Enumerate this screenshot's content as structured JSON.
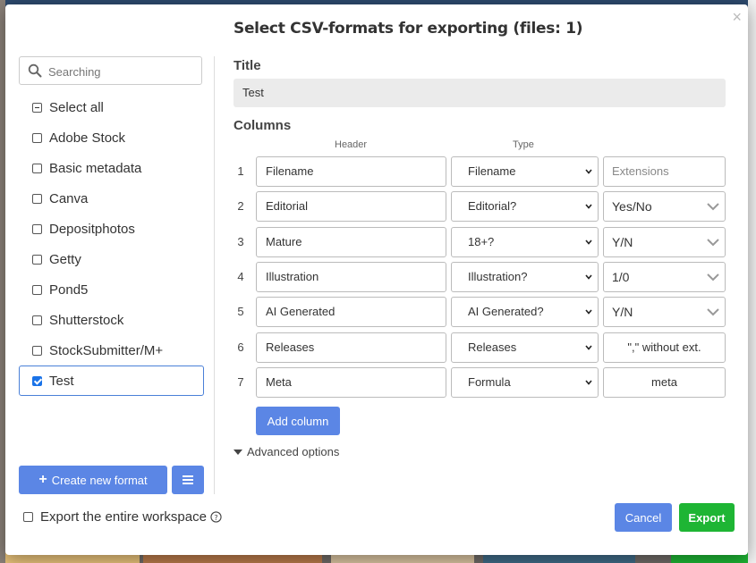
{
  "dialog": {
    "title": "Select CSV-formats for exporting (files: 1)",
    "close_glyph": "×"
  },
  "search": {
    "placeholder": "Searching",
    "value": ""
  },
  "formats": {
    "select_all_label": "Select all",
    "items": [
      {
        "label": "Adobe Stock",
        "checked": false
      },
      {
        "label": "Basic metadata",
        "checked": false
      },
      {
        "label": "Canva",
        "checked": false
      },
      {
        "label": "Depositphotos",
        "checked": false
      },
      {
        "label": "Getty",
        "checked": false
      },
      {
        "label": "Pond5",
        "checked": false
      },
      {
        "label": "Shutterstock",
        "checked": false
      },
      {
        "label": "StockSubmitter/M+",
        "checked": false
      },
      {
        "label": "Test",
        "checked": true
      }
    ],
    "create_label": "Create new format"
  },
  "editor": {
    "title_label": "Title",
    "title_value": "Test",
    "columns_label": "Columns",
    "header_col_label": "Header",
    "type_col_label": "Type",
    "rows": [
      {
        "num": "1",
        "header": "Filename",
        "type": "Filename",
        "extra": "Extensions",
        "extra_kind": "placeholder"
      },
      {
        "num": "2",
        "header": "Editorial",
        "type": "Editorial?",
        "extra": "Yes/No",
        "extra_kind": "select"
      },
      {
        "num": "3",
        "header": "Mature",
        "type": "18+?",
        "extra": "Y/N",
        "extra_kind": "select"
      },
      {
        "num": "4",
        "header": "Illustration",
        "type": "Illustration?",
        "extra": "1/0",
        "extra_kind": "select"
      },
      {
        "num": "5",
        "header": "AI Generated",
        "type": "AI Generated?",
        "extra": "Y/N",
        "extra_kind": "select"
      },
      {
        "num": "6",
        "header": "Releases",
        "type": "Releases",
        "extra": "\",\" without ext.",
        "extra_kind": "center"
      },
      {
        "num": "7",
        "header": "Meta",
        "type": "Formula",
        "extra": "meta",
        "extra_kind": "center"
      }
    ],
    "add_column_label": "Add column",
    "advanced_label": "Advanced options"
  },
  "footer": {
    "workspace_label": "Export the entire workspace",
    "cancel_label": "Cancel",
    "export_label": "Export"
  },
  "colors": {
    "primary": "#5b86e5",
    "success": "#1eb534",
    "selected_border": "#4a80d8"
  }
}
